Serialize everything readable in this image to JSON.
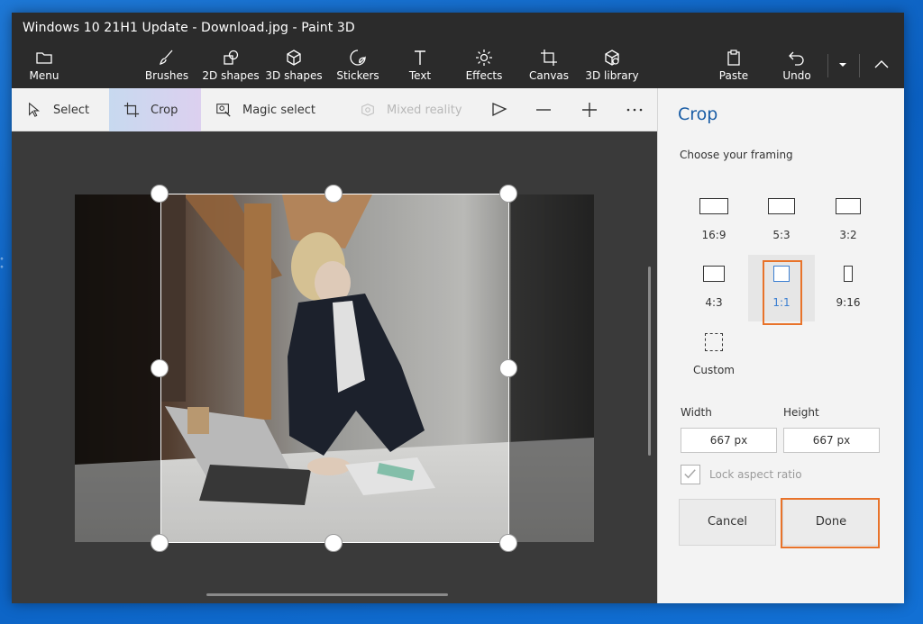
{
  "window": {
    "title": "Windows 10 21H1 Update - Download.jpg - Paint 3D"
  },
  "toolbar": {
    "menu": "Menu",
    "brushes": "Brushes",
    "shapes2d": "2D shapes",
    "shapes3d": "3D shapes",
    "stickers": "Stickers",
    "text": "Text",
    "effects": "Effects",
    "canvas": "Canvas",
    "library3d": "3D library",
    "paste": "Paste",
    "undo": "Undo"
  },
  "subtoolbar": {
    "select": "Select",
    "crop": "Crop",
    "magic_select": "Magic select",
    "mixed_reality": "Mixed reality"
  },
  "panel": {
    "title": "Crop",
    "subtitle": "Choose your framing",
    "framings": [
      {
        "label": "16:9"
      },
      {
        "label": "5:3"
      },
      {
        "label": "3:2"
      },
      {
        "label": "4:3"
      },
      {
        "label": "1:1"
      },
      {
        "label": "9:16"
      },
      {
        "label": "Custom"
      }
    ],
    "selected_framing": "1:1",
    "width_label": "Width",
    "height_label": "Height",
    "width_value": "667 px",
    "height_value": "667 px",
    "lock_label": "Lock aspect ratio",
    "lock_checked": true,
    "cancel": "Cancel",
    "done": "Done"
  },
  "colors": {
    "accent": "#1b5ea6",
    "highlight": "#e8732a",
    "chrome": "#2b2b2b"
  }
}
